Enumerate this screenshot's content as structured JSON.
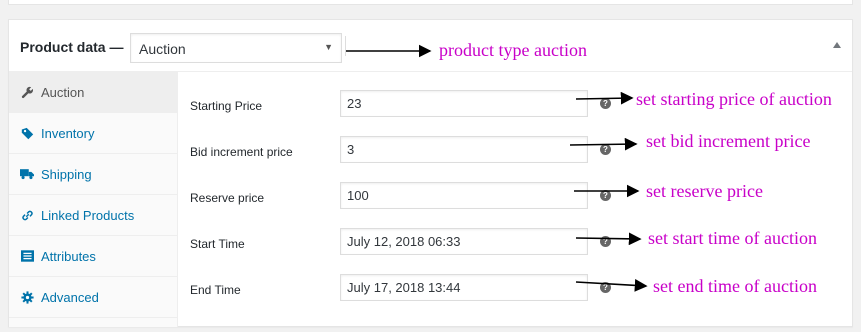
{
  "panel": {
    "title": "Product data —",
    "product_type_selected": "Auction"
  },
  "tabs": [
    {
      "label": "Auction",
      "icon": "wrench-icon",
      "active": true
    },
    {
      "label": "Inventory",
      "icon": "tag-icon",
      "active": false
    },
    {
      "label": "Shipping",
      "icon": "truck-icon",
      "active": false
    },
    {
      "label": "Linked Products",
      "icon": "link-icon",
      "active": false
    },
    {
      "label": "Attributes",
      "icon": "list-icon",
      "active": false
    },
    {
      "label": "Advanced",
      "icon": "gear-icon",
      "active": false
    }
  ],
  "fields": [
    {
      "label": "Starting Price",
      "value": "23"
    },
    {
      "label": "Bid increment price",
      "value": "3"
    },
    {
      "label": "Reserve price",
      "value": "100"
    },
    {
      "label": "Start Time",
      "value": "July 12, 2018 06:33"
    },
    {
      "label": "End Time",
      "value": "July 17, 2018 13:44"
    }
  ],
  "annotations": {
    "product_type": "product type auction",
    "starting_price": "set starting price of auction",
    "bid_increment": "set bid increment price",
    "reserve": "set reserve price",
    "start_time": "set start time of auction",
    "end_time": "set end time of auction"
  },
  "colors": {
    "annotation": "#c800c8",
    "link": "#0073aa",
    "active_tab_bg": "#eeeeee"
  }
}
